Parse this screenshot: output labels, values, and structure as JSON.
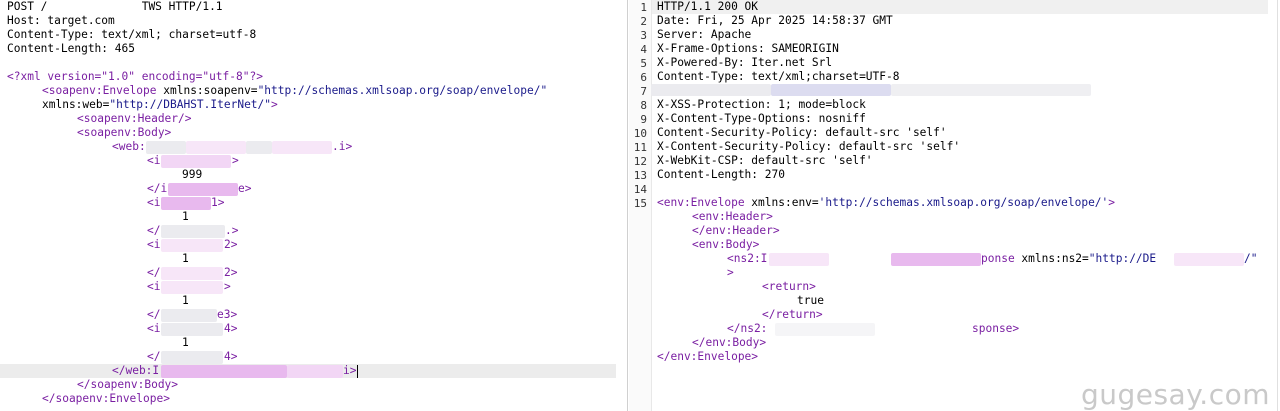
{
  "request": {
    "request_line": "POST /              TWS HTTP/1.1",
    "headers": [
      "Host: target.com",
      "Content-Type: text/xml; charset=utf-8",
      "Content-Length: 465"
    ],
    "xml_decl": "<?xml version=\"1.0\" encoding=\"utf-8\"?>",
    "envelope_open_1": "<soapenv:Envelope",
    "envelope_ns1_attr": " xmlns:soapenv=",
    "envelope_ns1_val": "\"http://schemas.xmlsoap.org/soap/envelope/\"",
    "envelope_ns2_attr": "xmlns:web=",
    "envelope_ns2_val": "\"http://DBAHST.IterNet/\"",
    "envelope_ns2_close": ">",
    "header_tag": "<soapenv:Header/>",
    "body_open": "<soapenv:Body>",
    "method_open": "<web:",
    "method_open_tail": ".i>",
    "param1_open": "<i",
    "param1_open_tail": ">",
    "param1_value": "999",
    "param1_close": "</i",
    "param1_close_tail": "e>",
    "param2_open": "<i",
    "param2_open_tail": "1>",
    "param2_value": "1",
    "param2_close": "</",
    "param2_close_tail": ".>",
    "param3_open": "<i",
    "param3_open_tail": "2>",
    "param3_value": "1",
    "param3_close": "</",
    "param3_close_tail": "2>",
    "param4_open": "<i",
    "param4_open_tail": ">",
    "param4_value": "1",
    "param4_close": "</",
    "param4_close_tail": "e3>",
    "param5_open": "<i",
    "param5_open_tail": "4>",
    "param5_value": "1",
    "param5_close": "</",
    "param5_close_tail": "4>",
    "method_close": "</web:I",
    "method_close_tail": "i>",
    "body_close": "</soapenv:Body>",
    "envelope_close": "</soapenv:Envelope>"
  },
  "response": {
    "line_numbers": [
      "1",
      "2",
      "3",
      "4",
      "5",
      "6",
      "7",
      "8",
      "9",
      "10",
      "11",
      "12",
      "13",
      "14",
      "15"
    ],
    "status_line": "HTTP/1.1 200 OK",
    "headers": [
      "Date: Fri, 25 Apr 2025 14:58:37 GMT",
      "Server: Apache",
      "X-Frame-Options: SAMEORIGIN",
      "X-Powered-By: Iter.net Srl",
      "Content-Type: text/xml;charset=UTF-8",
      "",
      "X-XSS-Protection: 1; mode=block",
      "X-Content-Type-Options: nosniff",
      "Content-Security-Policy: default-src 'self'",
      "X-Content-Security-Policy: default-src 'self'",
      "X-WebKit-CSP: default-src 'self'",
      "Content-Length: 270"
    ],
    "envelope_open": "<env:Envelope",
    "envelope_ns_attr": " xmlns:env=",
    "envelope_ns_val": "'http://schemas.xmlsoap.org/soap/envelope/'",
    "envelope_open_close": ">",
    "header_open": "<env:Header>",
    "header_close": "</env:Header>",
    "body_open": "<env:Body>",
    "ns2_open": "<ns2:I",
    "ns2_open_mid": "ponse",
    "ns2_attr": " xmlns:ns2=",
    "ns2_val": "\"http://DE",
    "ns2_val_tail": "/\"",
    "ns2_gt": ">",
    "return_open": "<return>",
    "return_value": "true",
    "return_close": "</return>",
    "ns2_close": "</ns2:",
    "ns2_close_tail": "sponse>",
    "body_close": "</env:Body>",
    "envelope_close": "</env:Envelope>"
  },
  "watermark": "gugesay.com"
}
